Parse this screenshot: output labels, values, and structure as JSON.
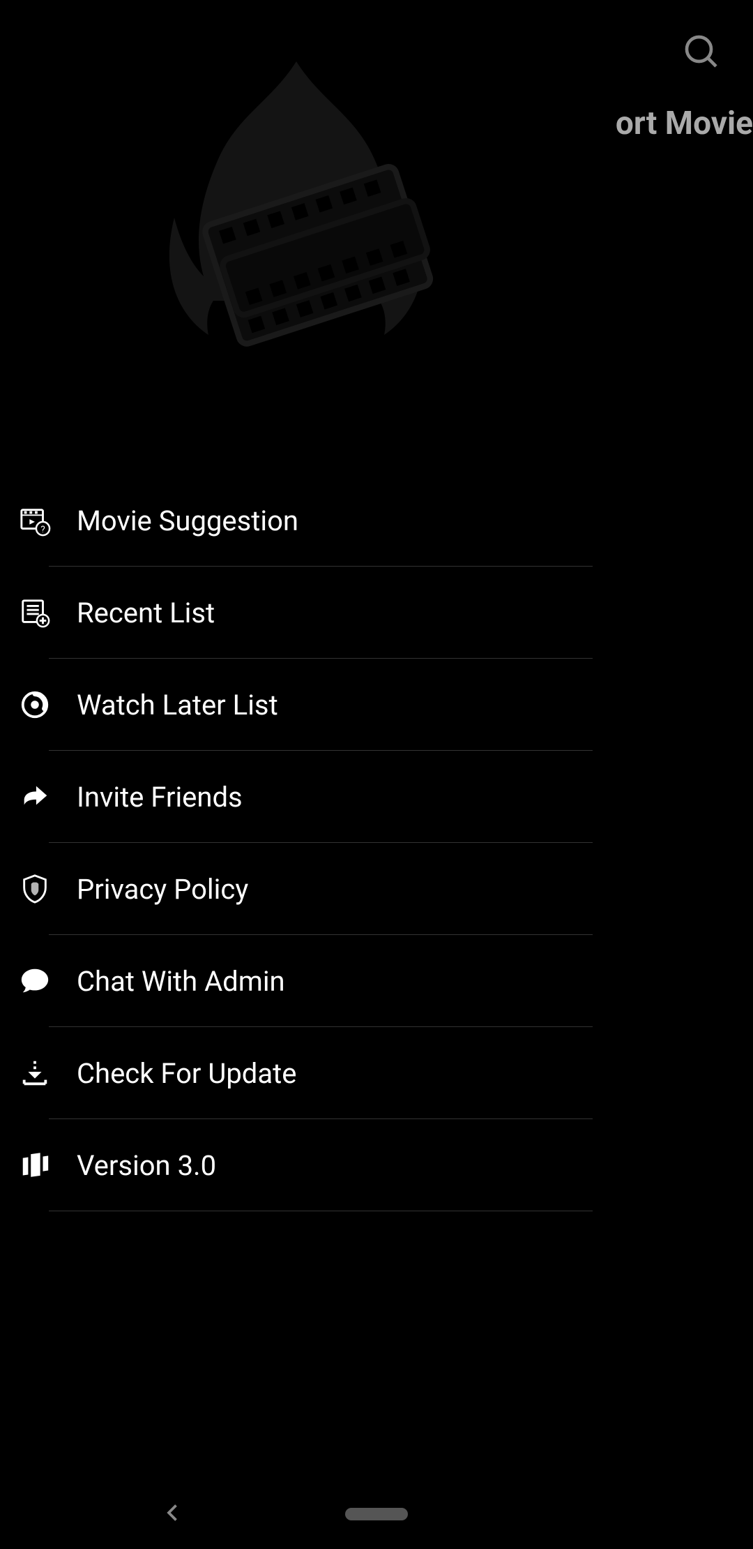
{
  "header": {
    "partial_text": "ort Movie"
  },
  "menu": {
    "items": [
      {
        "label": "Movie Suggestion",
        "icon": "movie-suggestion-icon",
        "name": "menu-movie-suggestion"
      },
      {
        "label": "Recent List",
        "icon": "recent-list-icon",
        "name": "menu-recent-list"
      },
      {
        "label": "Watch Later List",
        "icon": "watch-later-icon",
        "name": "menu-watch-later"
      },
      {
        "label": "Invite Friends",
        "icon": "share-icon",
        "name": "menu-invite-friends"
      },
      {
        "label": "Privacy Policy",
        "icon": "shield-icon",
        "name": "menu-privacy-policy"
      },
      {
        "label": "Chat With Admin",
        "icon": "chat-icon",
        "name": "menu-chat-admin"
      },
      {
        "label": "Check For Update",
        "icon": "download-icon",
        "name": "menu-check-update"
      },
      {
        "label": "Version 3.0",
        "icon": "version-icon",
        "name": "menu-version"
      }
    ]
  }
}
